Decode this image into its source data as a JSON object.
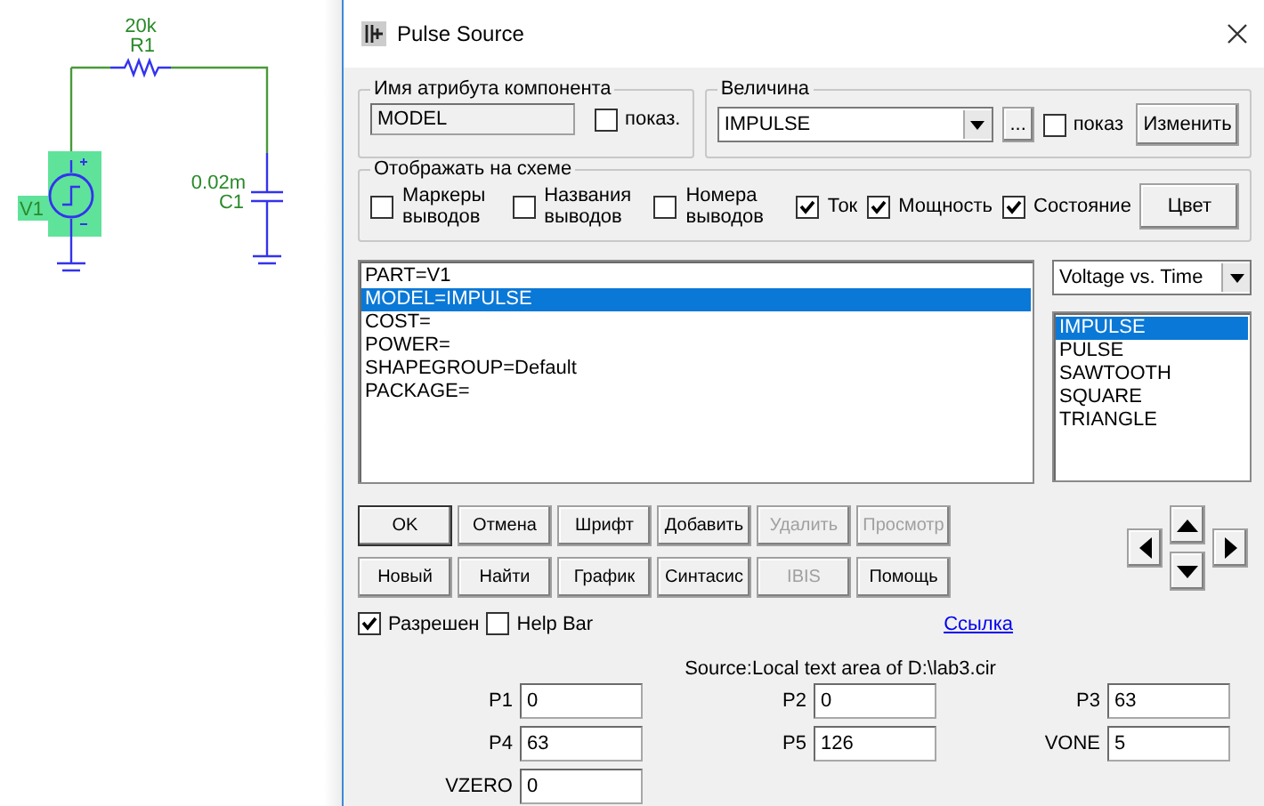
{
  "schematic": {
    "resistor": {
      "value": "20k",
      "name": "R1"
    },
    "capacitor": {
      "value": "0.02m",
      "name": "C1"
    },
    "source": {
      "name": "V1",
      "selected": true
    }
  },
  "window": {
    "title": "Pulse Source"
  },
  "attribute_group": {
    "title": "Имя атрибута компонента",
    "value": "MODEL",
    "show": {
      "label": "показ.",
      "checked": false
    }
  },
  "value_group": {
    "title": "Величина",
    "value": "IMPULSE",
    "more": "...",
    "show": {
      "label": "показ",
      "checked": false
    },
    "change_button": "Изменить"
  },
  "display_group": {
    "title": "Отображать на схеме",
    "options": [
      {
        "label": "Маркеры выводов",
        "checked": false
      },
      {
        "label": "Названия выводов",
        "checked": false
      },
      {
        "label": "Номера выводов",
        "checked": false
      },
      {
        "label": "Ток",
        "checked": true
      },
      {
        "label": "Мощность",
        "checked": true
      },
      {
        "label": "Состояние",
        "checked": true
      }
    ],
    "color_button": "Цвет"
  },
  "attributes": [
    {
      "text": "PART=V1",
      "selected": false
    },
    {
      "text": "MODEL=IMPULSE",
      "selected": true
    },
    {
      "text": "COST=",
      "selected": false
    },
    {
      "text": "POWER=",
      "selected": false
    },
    {
      "text": "SHAPEGROUP=Default",
      "selected": false
    },
    {
      "text": "PACKAGE=",
      "selected": false
    }
  ],
  "plot_select": "Voltage vs. Time",
  "models": [
    {
      "text": "IMPULSE",
      "selected": true
    },
    {
      "text": "PULSE",
      "selected": false
    },
    {
      "text": "SAWTOOTH",
      "selected": false
    },
    {
      "text": "SQUARE",
      "selected": false
    },
    {
      "text": "TRIANGLE",
      "selected": false
    }
  ],
  "button_rows": [
    [
      {
        "label": "OK",
        "disabled": false,
        "default": true
      },
      {
        "label": "Отмена",
        "disabled": false,
        "default": false
      },
      {
        "label": "Шрифт",
        "disabled": false,
        "default": false
      },
      {
        "label": "Добавить",
        "disabled": false,
        "default": false
      },
      {
        "label": "Удалить",
        "disabled": true,
        "default": false
      },
      {
        "label": "Просмотр",
        "disabled": true,
        "default": false
      }
    ],
    [
      {
        "label": "Новый",
        "disabled": false,
        "default": false
      },
      {
        "label": "Найти",
        "disabled": false,
        "default": false
      },
      {
        "label": "График",
        "disabled": false,
        "default": false
      },
      {
        "label": "Синтасис",
        "disabled": false,
        "default": false
      },
      {
        "label": "IBIS",
        "disabled": true,
        "default": false
      },
      {
        "label": "Помощь",
        "disabled": false,
        "default": false
      }
    ]
  ],
  "enabled": {
    "label": "Разрешен",
    "checked": true
  },
  "help_bar": {
    "label": "Help Bar",
    "checked": false
  },
  "link": "Ссылка",
  "source_text": "Source:Local text area of D:\\lab3.cir",
  "params": [
    {
      "label": "P1",
      "value": "0"
    },
    {
      "label": "P2",
      "value": "0"
    },
    {
      "label": "P3",
      "value": "63"
    },
    {
      "label": "P4",
      "value": "63"
    },
    {
      "label": "P5",
      "value": "126"
    },
    {
      "label": "VONE",
      "value": "5"
    },
    {
      "label": "VZERO",
      "value": "0"
    }
  ]
}
